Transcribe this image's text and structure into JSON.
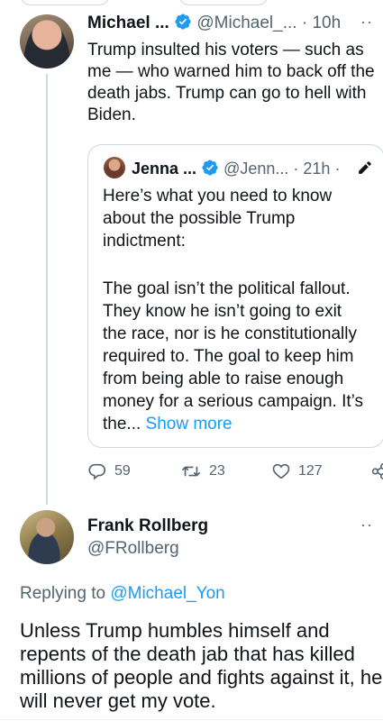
{
  "tweet": {
    "author_name": "Michael ...",
    "handle": "@Michael_...",
    "separator": "·",
    "time": "10h",
    "text_lines": [
      "Trump insulted his voters — such as",
      "me — who warned him to back off the",
      "death jabs.  Trump can go to hell with",
      "Biden."
    ],
    "more_icon": "more-dots-icon",
    "verified_icon": "verified-badge-icon"
  },
  "quote": {
    "author_name": "Jenna ...",
    "handle": "@Jenn...",
    "separator": "·",
    "time": "21h",
    "suffix": "·",
    "edit_icon": "pencil-edited-icon",
    "text_lines": [
      "Here’s what you need to know",
      "about the possible Trump",
      "indictment:",
      "",
      "The goal isn’t the political fallout.",
      "They know he isn’t going to exit",
      "the race, nor is he constitutionally",
      "required to. The goal to keep him",
      "from being able to raise enough",
      "money for a serious campaign. It’s"
    ],
    "truncated_text": "the...",
    "show_more": "Show more"
  },
  "actions": {
    "replies": "59",
    "retweets": "23",
    "likes": "127",
    "reply_icon": "reply-bubble-icon",
    "retweet_icon": "retweet-icon",
    "like_icon": "heart-icon",
    "share_icon": "share-icon"
  },
  "reply": {
    "author_name": "Frank Rollberg",
    "handle": "@FRollberg",
    "more_icon": "more-dots-icon",
    "replying_prefix": "Replying to ",
    "replying_handle": "@Michael_Yon",
    "text_lines": [
      "Unless Trump humbles himself and",
      "repents of the death jab that has killed",
      "millions of people and fights against it, he",
      "will never get my vote."
    ]
  },
  "colors": {
    "accent": "#1d9bf0",
    "muted": "#536471",
    "text": "#0f1419",
    "border": "#cfd9de"
  }
}
